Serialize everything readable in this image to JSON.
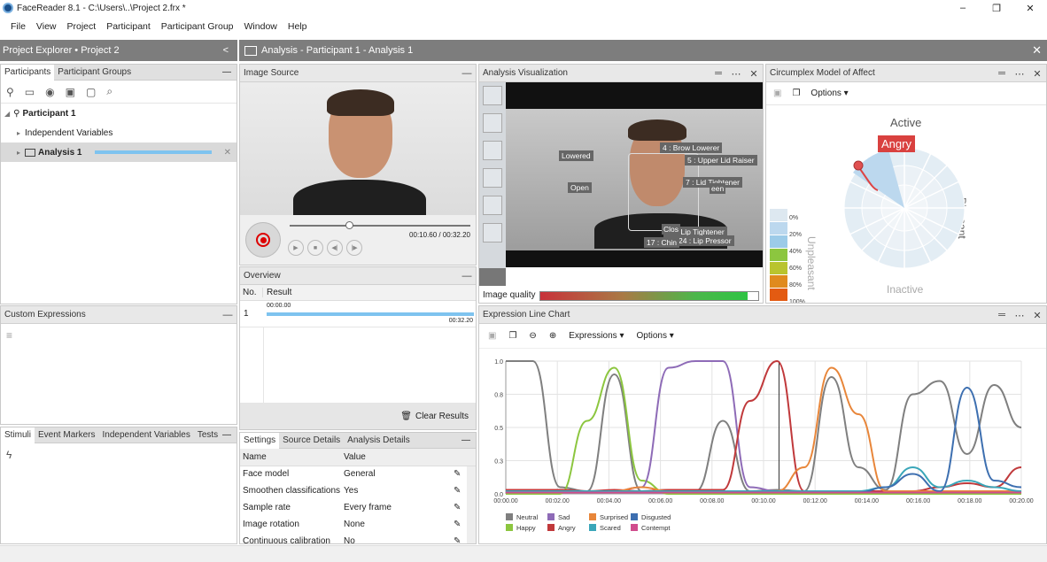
{
  "window": {
    "title": "FaceReader 8.1 - C:\\Users\\..\\Project 2.frx *",
    "controls": [
      "–",
      "❐",
      "✕"
    ]
  },
  "menu": [
    "File",
    "View",
    "Project",
    "Participant",
    "Participant Group",
    "Window",
    "Help"
  ],
  "project_explorer": {
    "title": "Project Explorer • Project 2",
    "collapse": "<",
    "tabs": [
      "Participants",
      "Participant Groups"
    ],
    "participant": "Participant 1",
    "independent_variables": "Independent Variables",
    "analysis": "Analysis 1"
  },
  "analysis_header": {
    "title": "Analysis - Participant 1 - Analysis 1",
    "close": "✕"
  },
  "custom_expressions": {
    "title": "Custom Expressions"
  },
  "stimuli_tabs": [
    "Stimuli",
    "Event Markers",
    "Independent Variables",
    "Tests"
  ],
  "image_source": {
    "title": "Image Source",
    "time": "00:10.60 / 00:32.20"
  },
  "overview": {
    "title": "Overview",
    "col_no": "No.",
    "col_result": "Result",
    "row_no": "1",
    "start": "00:00.00",
    "end": "00:32.20",
    "clear": "Clear Results"
  },
  "settings": {
    "tabs": [
      "Settings",
      "Source Details",
      "Analysis Details"
    ],
    "col_name": "Name",
    "col_value": "Value",
    "rows": [
      {
        "name": "Face model",
        "value": "General"
      },
      {
        "name": "Smoothen classifications",
        "value": "Yes"
      },
      {
        "name": "Sample rate",
        "value": "Every frame"
      },
      {
        "name": "Image rotation",
        "value": "None"
      },
      {
        "name": "Continuous calibration",
        "value": "No"
      }
    ]
  },
  "analysis_vis": {
    "title": "Analysis Visualization",
    "image_quality": "Image quality",
    "quality_value": 0.95,
    "labels": {
      "lowered": "Lowered",
      "open": "Open",
      "au4": "4 : Brow Lowerer",
      "au5": "5 : Upper Lid Raiser",
      "au7": "7 : Lid Tightener",
      "au23": "23 : Lip Tightener",
      "au24": "24 : Lip Pressor",
      "au17": "17 : Chin",
      "closed": "Clos",
      "seen": "een"
    }
  },
  "circumplex": {
    "title": "Circumplex Model of Affect",
    "options": "Options",
    "active": "Active",
    "inactive": "Inactive",
    "pleasant": "Pleasant",
    "unpleasant": "Unpleasant",
    "emotion": "Angry",
    "scale": [
      "0%",
      "20%",
      "40%",
      "60%",
      "80%",
      "100%"
    ],
    "scale_colors": [
      "#dde8f0",
      "#bcd8ee",
      "#9ccbe8",
      "#8cc63f",
      "#b9c42e",
      "#e08a1e",
      "#e35b12"
    ]
  },
  "expression_chart": {
    "title": "Expression Line Chart",
    "expressions_menu": "Expressions",
    "options_menu": "Options"
  },
  "chart_data": {
    "type": "line",
    "xlabel": "",
    "ylabel": "",
    "ylim": [
      0,
      1
    ],
    "x": [
      "00:00.00",
      "00:02.00",
      "00:04.00",
      "00:06.00",
      "00:08.00",
      "00:10.00",
      "00:12.00",
      "00:14.00",
      "00:16.00",
      "00:18.00",
      "00:20.00"
    ],
    "yticks": [
      "0.0",
      "0.3",
      "0.5",
      "0.8",
      "1.0"
    ],
    "cursor_time": 10.6,
    "series": [
      {
        "name": "Neutral",
        "color": "#7f7f7f",
        "values": [
          1.0,
          1.0,
          0.05,
          0.02,
          0.9,
          0.02,
          0.03,
          0.02,
          0.55,
          0.02,
          0.03,
          0.02,
          0.88,
          0.2,
          0.03,
          0.75,
          0.85,
          0.3,
          0.82,
          0.5
        ]
      },
      {
        "name": "Happy",
        "color": "#8cc63f",
        "values": [
          0.0,
          0.0,
          0.0,
          0.55,
          0.95,
          0.1,
          0.0,
          0.0,
          0.0,
          0.0,
          0.0,
          0.0,
          0.0,
          0.0,
          0.0,
          0.0,
          0.0,
          0.0,
          0.0,
          0.0
        ]
      },
      {
        "name": "Sad",
        "color": "#8e6bb7",
        "values": [
          0.02,
          0.02,
          0.02,
          0.02,
          0.02,
          0.05,
          0.95,
          1.0,
          1.0,
          0.05,
          0.02,
          0.02,
          0.02,
          0.02,
          0.02,
          0.02,
          0.02,
          0.02,
          0.02,
          0.02
        ]
      },
      {
        "name": "Angry",
        "color": "#c0393b",
        "values": [
          0.03,
          0.03,
          0.03,
          0.02,
          0.03,
          0.02,
          0.03,
          0.03,
          0.03,
          0.7,
          1.0,
          0.02,
          0.02,
          0.02,
          0.02,
          0.02,
          0.05,
          0.08,
          0.05,
          0.2
        ]
      },
      {
        "name": "Surprised",
        "color": "#e8863a",
        "values": [
          0.02,
          0.02,
          0.02,
          0.02,
          0.02,
          0.05,
          0.02,
          0.02,
          0.02,
          0.02,
          0.02,
          0.2,
          0.95,
          0.6,
          0.02,
          0.02,
          0.02,
          0.02,
          0.02,
          0.02
        ]
      },
      {
        "name": "Scared",
        "color": "#3aa6b9",
        "values": [
          0.02,
          0.02,
          0.02,
          0.02,
          0.02,
          0.02,
          0.02,
          0.02,
          0.02,
          0.02,
          0.02,
          0.02,
          0.02,
          0.02,
          0.05,
          0.2,
          0.05,
          0.1,
          0.05,
          0.02
        ]
      },
      {
        "name": "Disgusted",
        "color": "#3d6fb0",
        "values": [
          0.01,
          0.01,
          0.01,
          0.01,
          0.01,
          0.01,
          0.01,
          0.01,
          0.01,
          0.01,
          0.01,
          0.01,
          0.01,
          0.01,
          0.05,
          0.15,
          0.02,
          0.8,
          0.1,
          0.05
        ]
      },
      {
        "name": "Contempt",
        "color": "#d04c8d",
        "values": [
          0.01,
          0.01,
          0.01,
          0.01,
          0.01,
          0.01,
          0.01,
          0.01,
          0.01,
          0.01,
          0.01,
          0.01,
          0.01,
          0.01,
          0.01,
          0.01,
          0.01,
          0.01,
          0.01,
          0.01
        ]
      }
    ]
  }
}
